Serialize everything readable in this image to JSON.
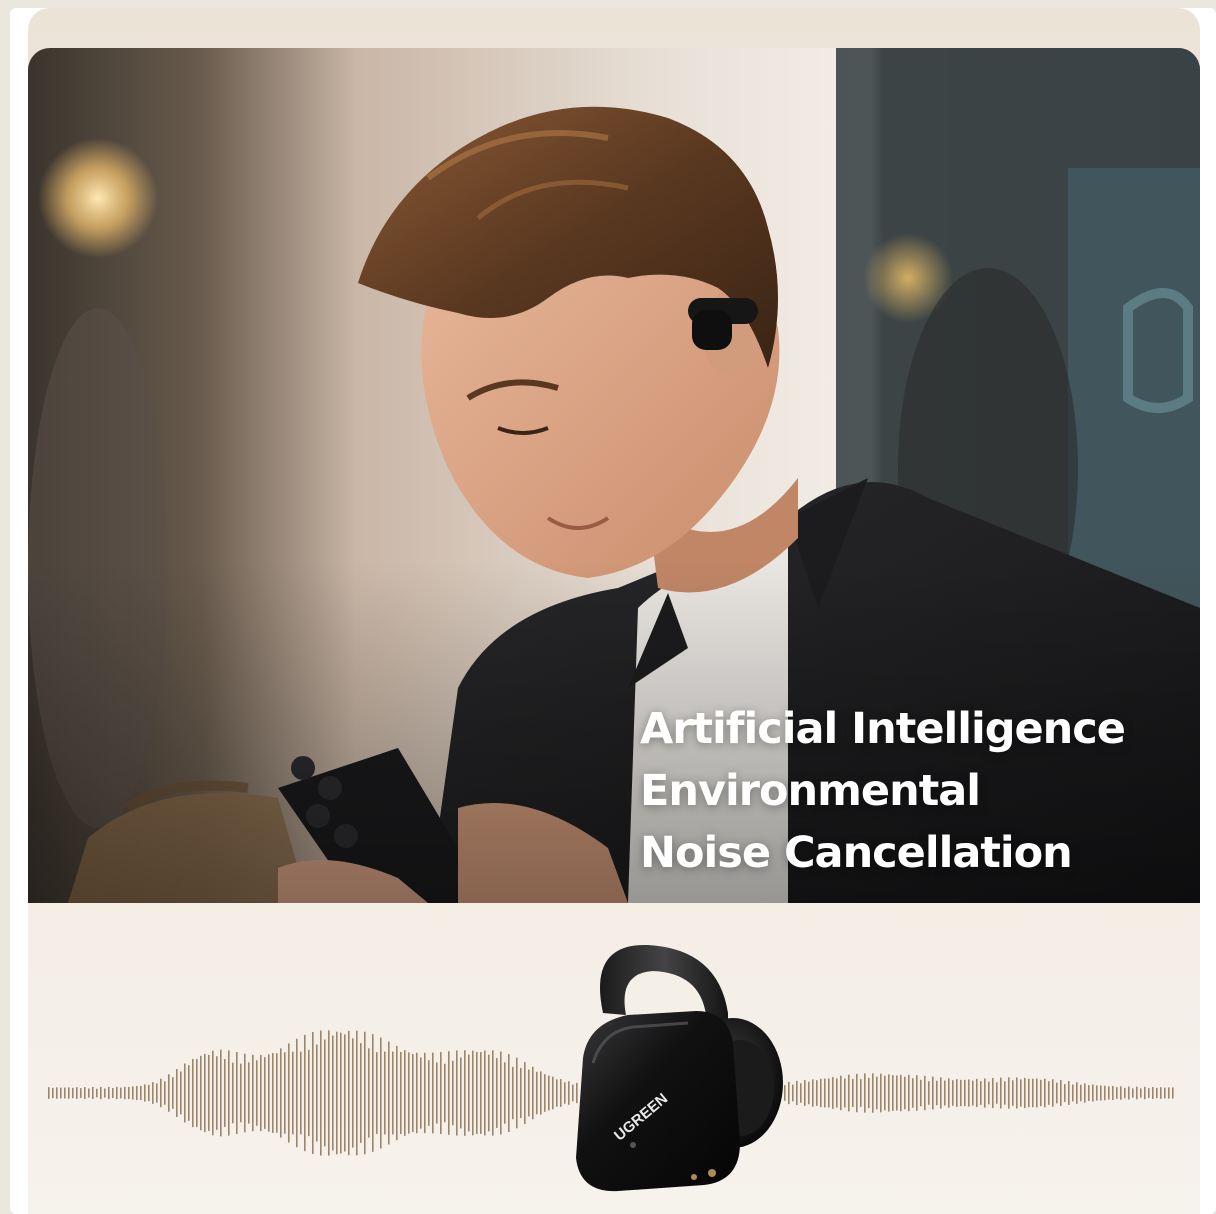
{
  "headline": {
    "line1": "Artificial Intelligence",
    "line2": "Environmental",
    "line3": "Noise Cancellation"
  },
  "product": {
    "brand": "UGREEN"
  },
  "icons": {
    "earbud": "earbud-icon",
    "phone": "smartphone-icon",
    "sound_wave": "sound-wave-icon"
  },
  "colors": {
    "accent_wave": "#8c7354",
    "headline_text": "#ffffff",
    "earbud_body": "#141414"
  }
}
